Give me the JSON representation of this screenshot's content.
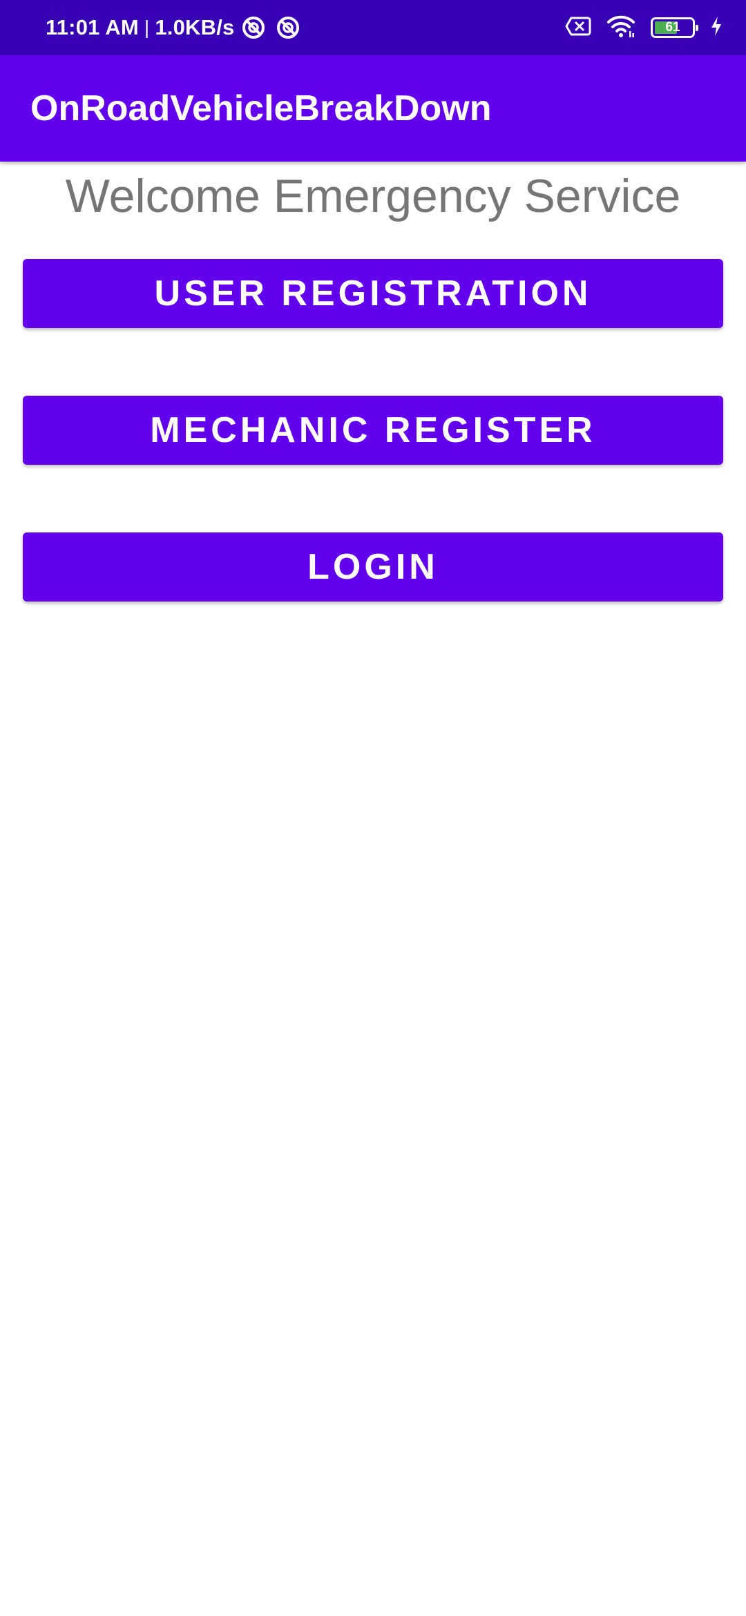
{
  "status_bar": {
    "time": "11:01 AM",
    "separator": "|",
    "speed": "1.0KB/s",
    "battery_level": "61",
    "battery_fraction": 0.61,
    "icons": [
      "vpn-icon",
      "vpn-icon",
      "sim-missing-icon",
      "wifi-icon",
      "battery-icon",
      "charging-icon"
    ],
    "background_color": "#3700B3"
  },
  "app_bar": {
    "title": "OnRoadVehicleBreakDown",
    "background_color": "#6200EE"
  },
  "main": {
    "welcome_text": "Welcome Emergency Service",
    "buttons": [
      {
        "label": "USER REGISTRATION"
      },
      {
        "label": "MECHANIC REGISTER"
      },
      {
        "label": "LOGIN"
      }
    ],
    "button_color": "#6200EE"
  }
}
